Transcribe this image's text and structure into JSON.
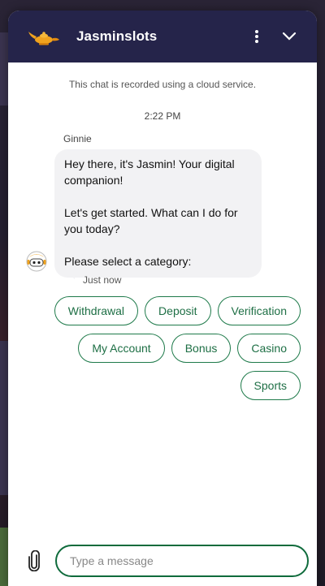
{
  "header": {
    "title": "Jasminslots"
  },
  "chat": {
    "notice": "This chat is recorded using a cloud service.",
    "time": "2:22 PM",
    "sender": "Ginnie",
    "message": {
      "p1": "Hey there, it's Jasmin! Your digital companion!",
      "p2": "Let's get started. What can I do for you today?",
      "p3": "Please select a category:"
    },
    "stamp": "Just now"
  },
  "categories": [
    "Withdrawal",
    "Deposit",
    "Verification",
    "My Account",
    "Bonus",
    "Casino",
    "Sports"
  ],
  "composer": {
    "placeholder": "Type a message"
  },
  "colors": {
    "header_bg": "#25244a",
    "accent_green": "#1e7a4a",
    "bubble_bg": "#f2f2f4"
  },
  "icons": [
    "genie-lamp-logo-icon",
    "more-vertical-icon",
    "chevron-down-icon",
    "bot-avatar-icon",
    "paperclip-icon"
  ]
}
